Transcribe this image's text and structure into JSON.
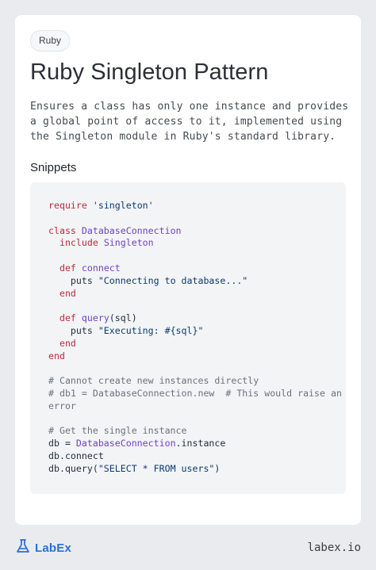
{
  "tag": "Ruby",
  "title": "Ruby Singleton Pattern",
  "description_lines": [
    "Ensures a class has only one instance and provides",
    "a global point of access to it, implemented using",
    "the Singleton module in Ruby's standard library."
  ],
  "snippets_heading": "Snippets",
  "code": {
    "l1": {
      "kw": "require",
      "st": " 'singleton'"
    },
    "l3": {
      "kw": "class",
      "ty": " DatabaseConnection"
    },
    "l4": {
      "indent": "  ",
      "kw": "include",
      "ty": " Singleton"
    },
    "l6": {
      "indent": "  ",
      "kw": "def",
      "ty": " connect"
    },
    "l7": {
      "indent": "    ",
      "fn": "puts",
      "st": " \"Connecting to database...\""
    },
    "l8": {
      "indent": "  ",
      "kw": "end"
    },
    "l10": {
      "indent": "  ",
      "kw": "def",
      "ty": " query",
      "rest": "(sql)"
    },
    "l11": {
      "indent": "    ",
      "fn": "puts",
      "st": " \"Executing: #{sql}\""
    },
    "l12": {
      "indent": "  ",
      "kw": "end"
    },
    "l13": {
      "kw": "end"
    },
    "l15": {
      "cm": "# Cannot create new instances directly"
    },
    "l16": {
      "cm": "# db1 = DatabaseConnection.new  # This would raise an"
    },
    "l17": {
      "cm": "error"
    },
    "l19": {
      "cm": "# Get the single instance"
    },
    "l20": {
      "a": "db = ",
      "ty": "DatabaseConnection",
      "b": ".instance"
    },
    "l21": {
      "a": "db.connect"
    },
    "l22": {
      "a": "db.query(",
      "st": "\"SELECT * FROM users\"",
      "b": ")"
    }
  },
  "footer": {
    "brand": "LabEx",
    "url": "labex.io"
  },
  "colors": {
    "keyword": "#c0283d",
    "type": "#6f42c1",
    "string": "#0d3a6e",
    "comment": "#6a737d",
    "brand": "#2b6fd6"
  }
}
